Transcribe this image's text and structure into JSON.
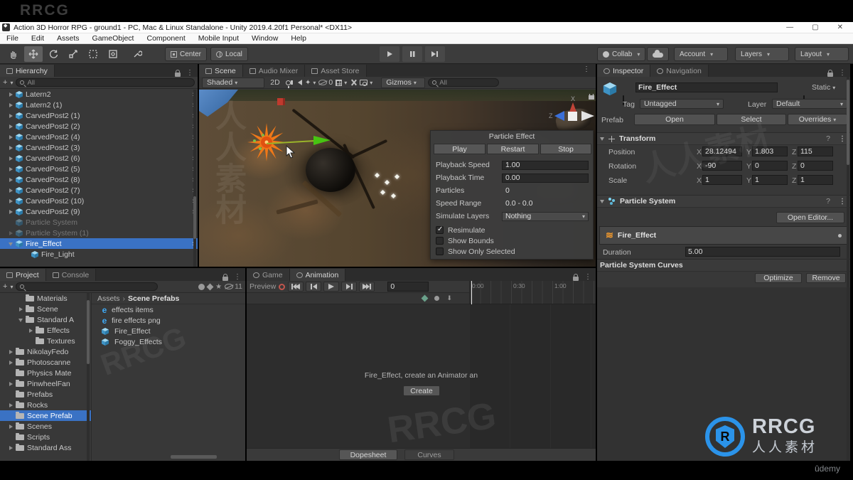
{
  "watermarks": {
    "top_left": "RRCG",
    "logo_title": "RRCG",
    "logo_subtitle": "人人素材",
    "udemy": "ûdemy",
    "ghost_cn": "人人素材",
    "ghost_rrcg": "RRCG"
  },
  "title_bar": {
    "title": "Action 3D Horror RPG - ground1 - PC, Mac & Linux Standalone - Unity 2019.4.20f1 Personal* <DX11>",
    "minimize": "—",
    "maximize": "▢",
    "close": "✕"
  },
  "menu": {
    "items": [
      "File",
      "Edit",
      "Assets",
      "GameObject",
      "Component",
      "Mobile Input",
      "Window",
      "Help"
    ]
  },
  "toolbar": {
    "pivot": "Center",
    "space": "Local",
    "collab": "Collab",
    "account": "Account",
    "layers": "Layers",
    "layout": "Layout"
  },
  "hierarchy": {
    "tab": "Hierarchy",
    "search": "All",
    "items": [
      {
        "label": "Latern2",
        "arrow": "right",
        "chev": true
      },
      {
        "label": "Latern2 (1)",
        "arrow": "right",
        "chev": true
      },
      {
        "label": "CarvedPost2 (1)",
        "arrow": "right",
        "chev": true
      },
      {
        "label": "CarvedPost2 (2)",
        "arrow": "right",
        "chev": true
      },
      {
        "label": "CarvedPost2 (4)",
        "arrow": "right",
        "chev": true
      },
      {
        "label": "CarvedPost2 (3)",
        "arrow": "right",
        "chev": true
      },
      {
        "label": "CarvedPost2 (6)",
        "arrow": "right",
        "chev": true
      },
      {
        "label": "CarvedPost2 (5)",
        "arrow": "right",
        "chev": true
      },
      {
        "label": "CarvedPost2 (8)",
        "arrow": "right",
        "chev": true
      },
      {
        "label": "CarvedPost2 (7)",
        "arrow": "right",
        "chev": true
      },
      {
        "label": "CarvedPost2 (10)",
        "arrow": "right",
        "chev": true
      },
      {
        "label": "CarvedPost2 (9)",
        "arrow": "right",
        "chev": true
      },
      {
        "label": "Particle System",
        "disabled": true
      },
      {
        "label": "Particle System (1)",
        "disabled": true,
        "arrow": "right"
      },
      {
        "label": "Fire_Effect",
        "selected": true,
        "arrow": "down",
        "chev": true
      },
      {
        "label": "Fire_Light",
        "child": true
      }
    ]
  },
  "scene": {
    "tabs": [
      {
        "label": "Scene",
        "active": true
      },
      {
        "label": "Audio Mixer"
      },
      {
        "label": "Asset Store"
      }
    ],
    "shaded": "Shaded",
    "mode_2d": "2D",
    "hidden_count": "0",
    "gizmos": "Gizmos",
    "search": "All",
    "axis_x": "X",
    "axis_z": "Z"
  },
  "particle_panel": {
    "title": "Particle Effect",
    "play": "Play",
    "restart": "Restart",
    "stop": "Stop",
    "rows": [
      {
        "label": "Playback Speed",
        "value": "1.00",
        "kind": "field"
      },
      {
        "label": "Playback Time",
        "value": "0.00",
        "kind": "field"
      },
      {
        "label": "Particles",
        "value": "0",
        "kind": "text"
      },
      {
        "label": "Speed Range",
        "value": "0.0 - 0.0",
        "kind": "text"
      },
      {
        "label": "Simulate Layers",
        "value": "Nothing",
        "kind": "dropdown"
      }
    ],
    "checks": [
      {
        "label": "Resimulate",
        "checked": true
      },
      {
        "label": "Show Bounds"
      },
      {
        "label": "Show Only Selected"
      }
    ]
  },
  "inspector": {
    "tabs": [
      {
        "label": "Inspector",
        "active": true
      },
      {
        "label": "Navigation"
      }
    ],
    "name": "Fire_Effect",
    "static_label": "Static",
    "tag_label": "Tag",
    "tag_value": "Untagged",
    "layer_label": "Layer",
    "layer_value": "Default",
    "prefab_label": "Prefab",
    "open": "Open",
    "select": "Select",
    "overrides": "Overrides",
    "transform": {
      "title": "Transform",
      "axis": [
        "X",
        "Y",
        "Z"
      ],
      "rows": [
        {
          "label": "Position",
          "x": "28.12494",
          "y": "1.803",
          "z": "115"
        },
        {
          "label": "Rotation",
          "x": "-90",
          "y": "0",
          "z": "0"
        },
        {
          "label": "Scale",
          "x": "1",
          "y": "1",
          "z": "1"
        }
      ]
    },
    "particle_system": {
      "title": "Particle System",
      "open_editor": "Open Editor...",
      "module": "Fire_Effect",
      "duration_label": "Duration",
      "duration_value": "5.00",
      "curves_title": "Particle System Curves",
      "optimize": "Optimize",
      "remove": "Remove"
    }
  },
  "project": {
    "tabs": [
      {
        "label": "Project",
        "active": true
      },
      {
        "label": "Console"
      }
    ],
    "hidden_count": "11",
    "folders": [
      {
        "label": "Materials",
        "indent": 1
      },
      {
        "label": "Scene",
        "indent": 1,
        "arrow": "right"
      },
      {
        "label": "Standard A",
        "indent": 1,
        "arrow": "down",
        "open": true
      },
      {
        "label": "Effects",
        "indent": 2,
        "arrow": "right"
      },
      {
        "label": "Textures",
        "indent": 2
      },
      {
        "label": "NikolayFedo",
        "indent": 0,
        "arrow": "right"
      },
      {
        "label": "Photoscanne",
        "indent": 0,
        "arrow": "right"
      },
      {
        "label": "Physics Mate",
        "indent": 0
      },
      {
        "label": "PinwheelFan",
        "indent": 0,
        "arrow": "right"
      },
      {
        "label": "Prefabs",
        "indent": 0
      },
      {
        "label": "Rocks",
        "indent": 0,
        "arrow": "right"
      },
      {
        "label": "Scene Prefab",
        "indent": 0,
        "selected": true
      },
      {
        "label": "Scenes",
        "indent": 0,
        "arrow": "right"
      },
      {
        "label": "Scripts",
        "indent": 0
      },
      {
        "label": "Standard Ass",
        "indent": 0,
        "arrow": "right"
      }
    ],
    "breadcrumb": {
      "root": "Assets",
      "current": "Scene Prefabs"
    },
    "files": [
      {
        "label": "effects items",
        "icon": "e"
      },
      {
        "label": "fire effects png",
        "icon": "e"
      },
      {
        "label": "Fire_Effect",
        "icon": "cube"
      },
      {
        "label": "Foggy_Effects",
        "icon": "cube"
      }
    ]
  },
  "animation": {
    "tabs": [
      {
        "label": "Game"
      },
      {
        "label": "Animation",
        "active": true
      }
    ],
    "preview": "Preview",
    "frame": "0",
    "ticks": [
      "0:00",
      "0:30",
      "1:00"
    ],
    "message": "Fire_Effect, create an Animator an",
    "create": "Create",
    "dopesheet": "Dopesheet",
    "curves": "Curves"
  }
}
